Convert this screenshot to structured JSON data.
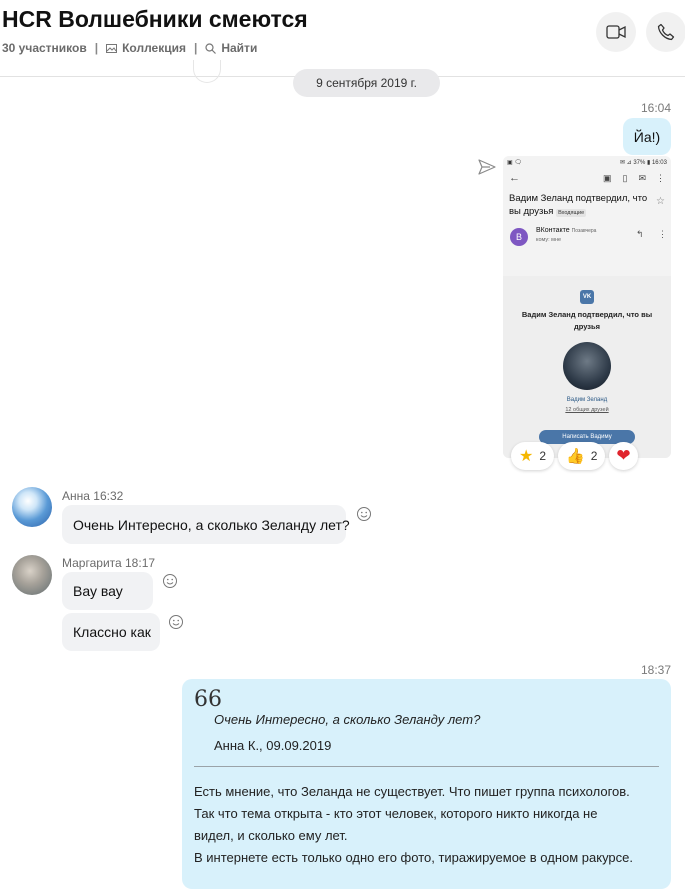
{
  "header": {
    "title": "HCR Волшебники смеются",
    "participants": "30 участников",
    "collection": "Коллекция",
    "find": "Найти"
  },
  "date_divider": "9 сентября 2019 г.",
  "messages": {
    "out1": {
      "time": "16:04",
      "text": "Йа!)"
    },
    "shot": {
      "status_left": "▣ 🗨",
      "status_right": "✉ ⊿ 37% ▮ 16:03",
      "subject": "Вадим Зеланд подтвердил, что вы друзья",
      "tag": "Входящие",
      "sender_initial": "В",
      "sender_name": "ВКонтакте",
      "sender_when": "Позавчера",
      "sender_to": "кому: мне",
      "card_logo": "VK",
      "card_title": "Вадим Зеланд подтвердил, что вы друзья",
      "card_name": "Вадим Зеланд",
      "card_friends": "12 общих друзей",
      "card_button": "Написать Вадиму"
    },
    "reactions": [
      {
        "icon": "star-emoji",
        "count": "2"
      },
      {
        "icon": "thumbs-up-emoji",
        "count": "2"
      },
      {
        "icon": "heart-emoji",
        "count": ""
      }
    ],
    "anna": {
      "sender": "Анна 16:32",
      "text": "Очень Интересно, а сколько Зеланду лет?"
    },
    "margarita": {
      "sender": "Маргарита 18:17",
      "text1": "Вау вау",
      "text2": "Классно как"
    },
    "out2": {
      "time": "18:37",
      "quote_mark": "66",
      "quote_text": "Очень Интересно, а сколько Зеланду лет?",
      "quote_author": "Анна К., 09.09.2019",
      "lines": [
        "Есть мнение, что Зеланда не существует. Что пишет группа психологов.",
        "Так что тема открыта - кто этот человек, которого никто никогда не",
        "видел, и сколько ему лет.",
        "В интернете есть только одно его фото, тиражируемое в одном ракурсе."
      ]
    }
  },
  "colors": {
    "outgoing": "#d8f1fb",
    "incoming": "#f1f2f4",
    "accent": "#0078d4",
    "vk": "#4a76a8"
  }
}
